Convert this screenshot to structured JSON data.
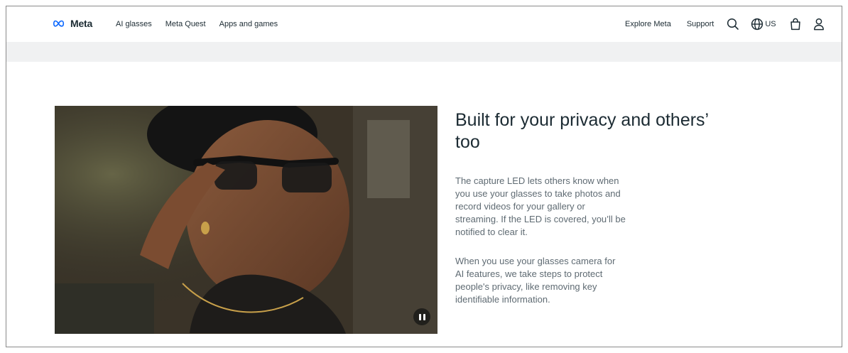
{
  "nav": {
    "brand": "Meta",
    "left_links": [
      "AI glasses",
      "Meta Quest",
      "Apps and games"
    ],
    "right_links": [
      "Explore Meta",
      "Support"
    ],
    "locale": "US",
    "icons": [
      "search-icon",
      "globe-icon",
      "shopping-bag-icon",
      "user-icon"
    ]
  },
  "feature": {
    "title": "Built for your privacy and others’ too",
    "paragraphs": [
      "The capture LED lets others know when you use your glasses to take photos and record videos for your gallery or streaming. If the LED is covered, you’ll be notified to clear it.",
      "When you use your glasses camera for AI features, we take steps to protect people's privacy, like removing key identifiable information."
    ]
  },
  "video": {
    "control_icon": "pause-icon"
  },
  "colors": {
    "text_primary": "#1c2b33",
    "text_secondary": "#5f6b73",
    "subbar": "#f0f1f2",
    "brand_blue": "#0866ff"
  }
}
